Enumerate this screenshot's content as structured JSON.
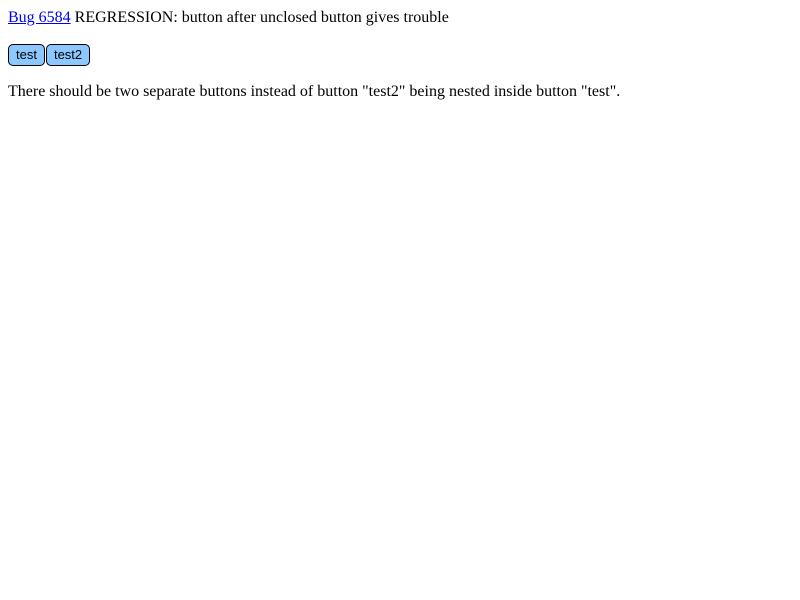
{
  "title": {
    "link_text": "Bug 6584",
    "rest": " REGRESSION: button after unclosed button gives trouble"
  },
  "buttons": [
    {
      "label": "test"
    },
    {
      "label": "test2"
    }
  ],
  "description": "There should be two separate buttons instead of button \"test2\" being nested inside button \"test\".",
  "colors": {
    "button_bg": "#8cc8ff",
    "link": "#0000ee"
  }
}
